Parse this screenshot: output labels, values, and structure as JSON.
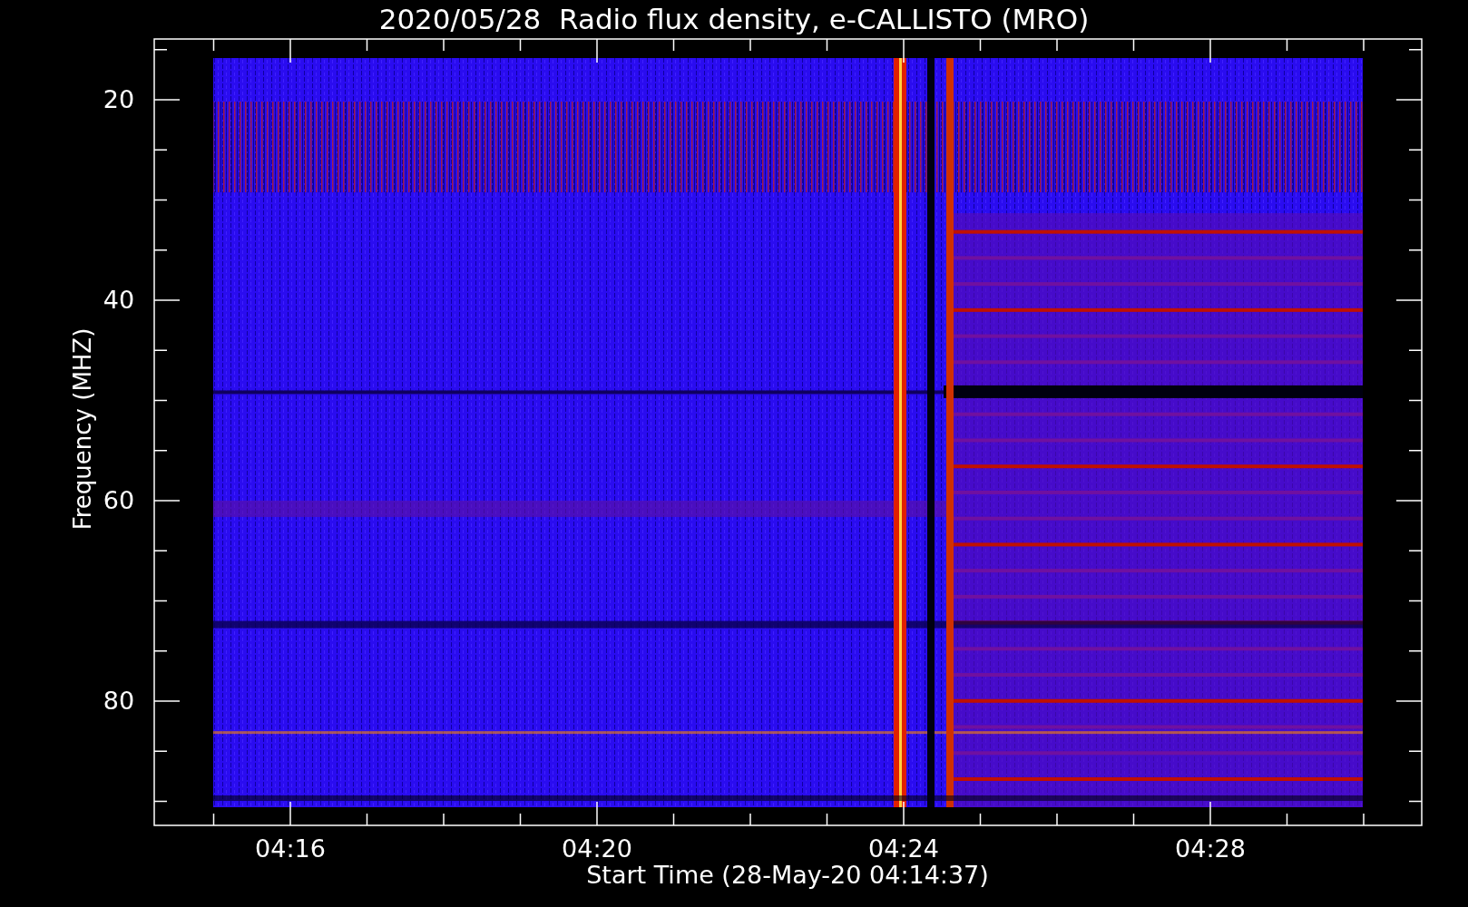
{
  "title": "2020/05/28  Radio flux density, e-CALLISTO (MRO)",
  "y_axis": {
    "label": "Frequency (MHZ)",
    "tick_labels": [
      "20",
      "40",
      "60",
      "80"
    ]
  },
  "x_axis": {
    "label": "Start Time (28-May-20 04:14:37)",
    "tick_labels": [
      "04:16",
      "04:20",
      "04:24",
      "04:28"
    ]
  }
}
